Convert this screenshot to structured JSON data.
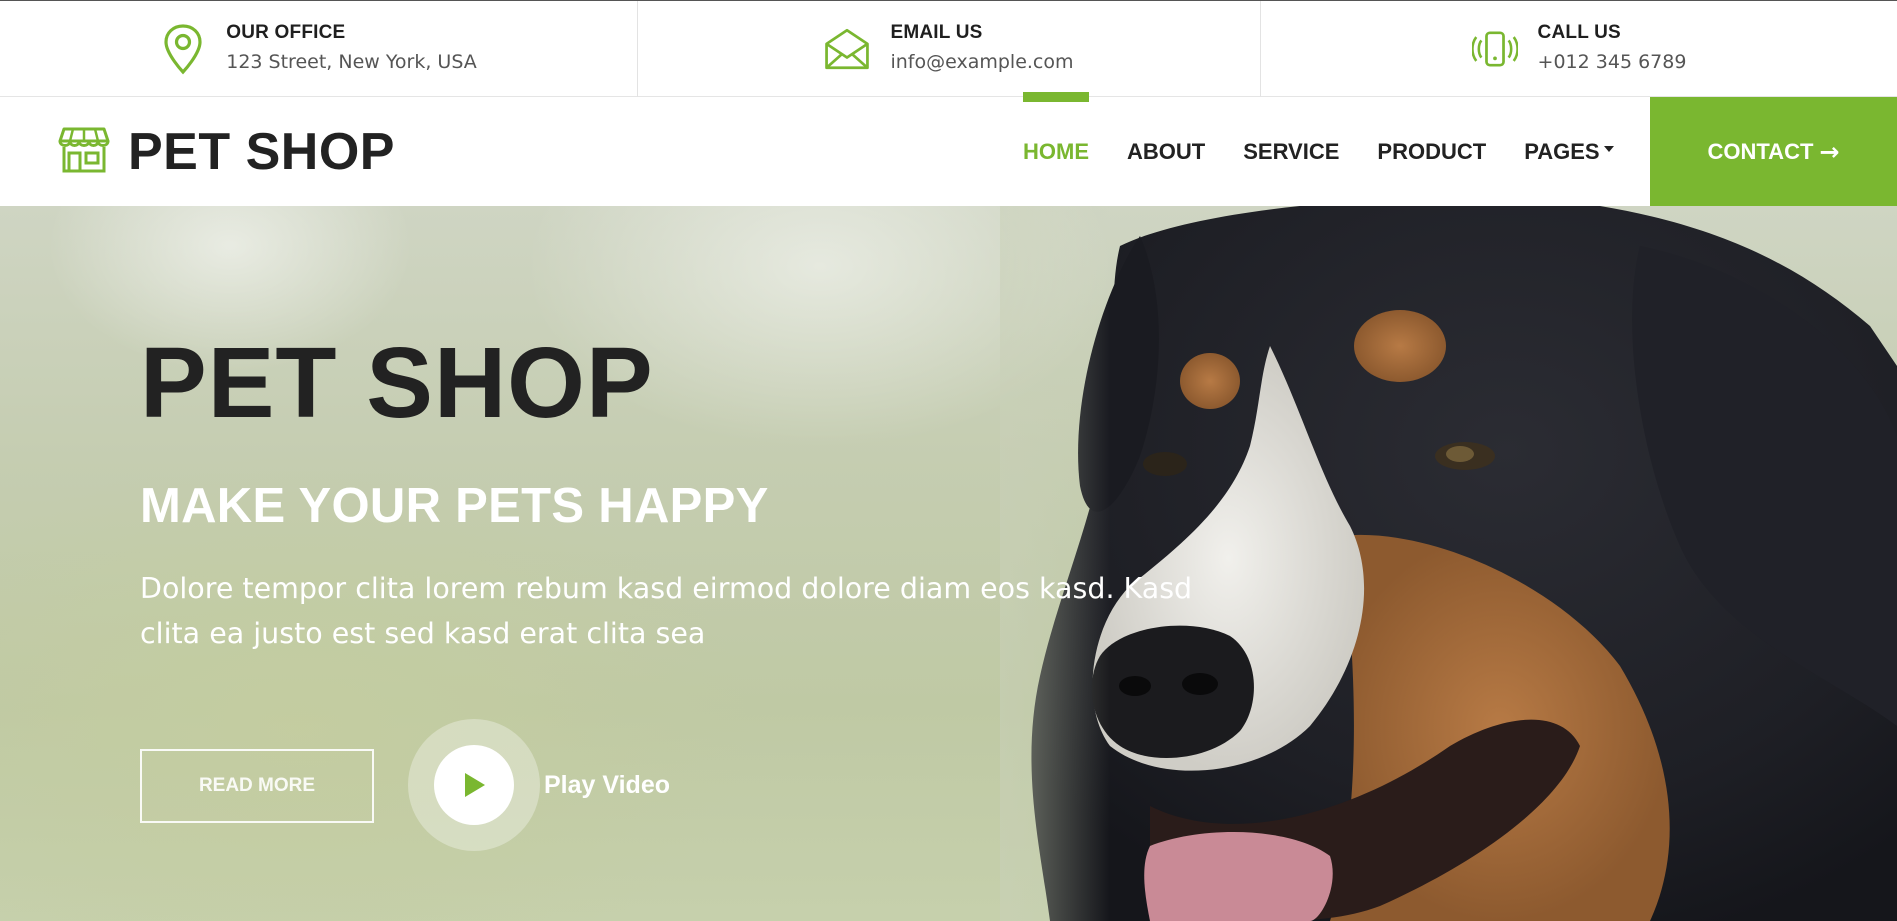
{
  "topbar": {
    "office": {
      "title": "OUR OFFICE",
      "value": "123 Street, New York, USA",
      "icon": "map-pin-icon"
    },
    "email": {
      "title": "EMAIL US",
      "value": "info@example.com",
      "icon": "envelope-open-icon"
    },
    "call": {
      "title": "CALL US",
      "value": "+012 345 6789",
      "icon": "phone-vibrate-icon"
    }
  },
  "brand": {
    "name": "PET SHOP",
    "icon": "shop-icon"
  },
  "nav": {
    "items": [
      {
        "label": "HOME",
        "active": true
      },
      {
        "label": "ABOUT"
      },
      {
        "label": "SERVICE"
      },
      {
        "label": "PRODUCT"
      },
      {
        "label": "PAGES",
        "dropdown": true
      }
    ],
    "contact_label": "CONTACT"
  },
  "hero": {
    "title": "PET SHOP",
    "subtitle": "MAKE YOUR PETS HAPPY",
    "text": "Dolore tempor clita lorem rebum kasd eirmod dolore diam eos kasd. Kasd clita ea justo est sed kasd erat clita sea",
    "read_more": "READ MORE",
    "play_label": "Play Video"
  },
  "colors": {
    "accent": "#7ab730",
    "dark": "#222222"
  }
}
